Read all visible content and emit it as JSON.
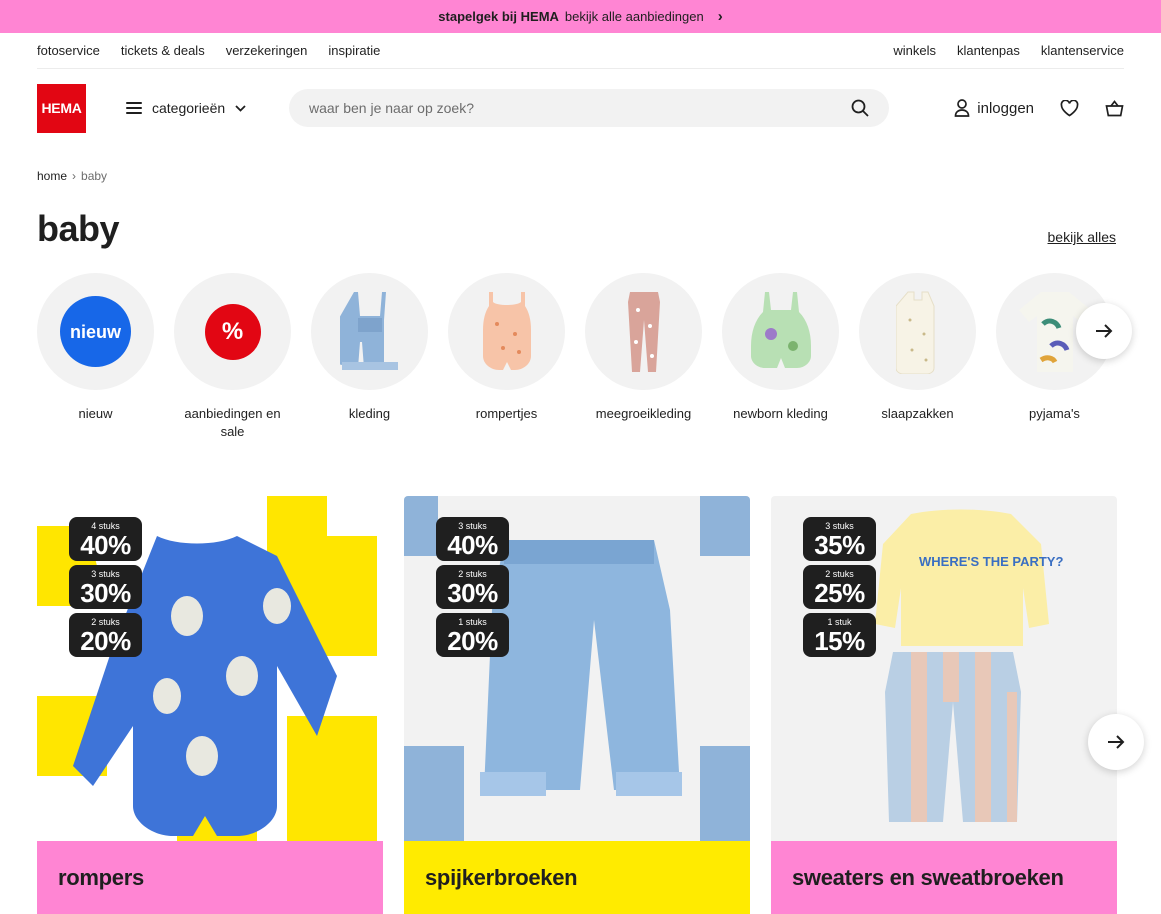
{
  "promo": {
    "bold": "stapelgek bij HEMA",
    "text": "bekijk alle aanbiedingen",
    "chevron": "›"
  },
  "utility_nav": {
    "left": [
      "fotoservice",
      "tickets & deals",
      "verzekeringen",
      "inspiratie"
    ],
    "right": [
      "winkels",
      "klantenpas",
      "klantenservice"
    ]
  },
  "header": {
    "logo": "HEMA",
    "categories_label": "categorieën",
    "search_placeholder": "waar ben je naar op zoek?",
    "login_label": "inloggen"
  },
  "breadcrumb": {
    "home": "home",
    "separator": "›",
    "current": "baby"
  },
  "page": {
    "title": "baby",
    "see_all": "bekijk alles"
  },
  "categories": [
    {
      "label": "nieuw",
      "badge": "nieuw",
      "icon": "new-badge"
    },
    {
      "label": "aanbiedingen en sale",
      "badge": "%",
      "icon": "percent-badge"
    },
    {
      "label": "kleding",
      "icon": "denim-overall"
    },
    {
      "label": "rompertjes",
      "icon": "romper"
    },
    {
      "label": "meegroeikleding",
      "icon": "leggings"
    },
    {
      "label": "newborn kleding",
      "icon": "green-overall"
    },
    {
      "label": "slaapzakken",
      "icon": "sleeping-bag"
    },
    {
      "label": "pyjama's",
      "icon": "dino-pyjama"
    }
  ],
  "products": [
    {
      "label": "rompers",
      "color": "#ff85d3",
      "discounts": [
        {
          "qty": "4 stuks",
          "pct": "40%"
        },
        {
          "qty": "3 stuks",
          "pct": "30%"
        },
        {
          "qty": "2 stuks",
          "pct": "20%"
        }
      ]
    },
    {
      "label": "spijkerbroeken",
      "color": "#ffeb00",
      "discounts": [
        {
          "qty": "3 stuks",
          "pct": "40%"
        },
        {
          "qty": "2 stuks",
          "pct": "30%"
        },
        {
          "qty": "1 stuks",
          "pct": "20%"
        }
      ]
    },
    {
      "label": "sweaters en sweatbroeken",
      "color": "#ff85d3",
      "print": "WHERE'S THE PARTY?",
      "discounts": [
        {
          "qty": "3 stuks",
          "pct": "35%"
        },
        {
          "qty": "2 stuks",
          "pct": "25%"
        },
        {
          "qty": "1 stuk",
          "pct": "15%"
        }
      ]
    }
  ],
  "colors": {
    "brand_red": "#e20613",
    "promo_pink": "#ff85d3",
    "yellow": "#ffeb00",
    "blue": "#1767e8"
  }
}
